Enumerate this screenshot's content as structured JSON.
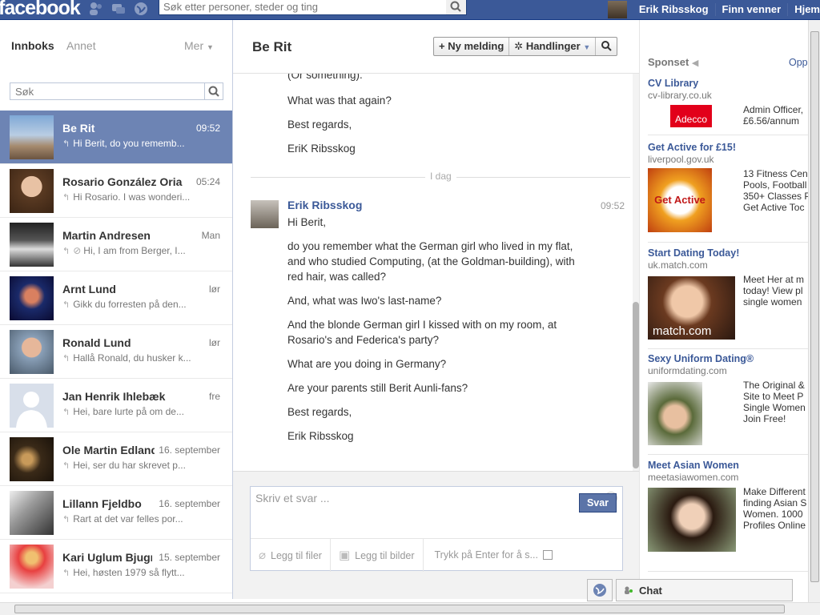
{
  "topbar": {
    "logo": "facebook",
    "search_placeholder": "Søk etter personer, steder og ting",
    "user_name": "Erik Ribsskog",
    "find_friends": "Finn venner",
    "home": "Hjem"
  },
  "inbox": {
    "tab_inbox": "Innboks",
    "tab_other": "Annet",
    "more": "Mer",
    "search_placeholder": "Søk",
    "threads": [
      {
        "name": "Be Rit",
        "time": "09:52",
        "snippet": "Hi Berit, do you rememb..."
      },
      {
        "name": "Rosario González Oria",
        "time": "05:24",
        "snippet": "Hi Rosario. I was wonderi..."
      },
      {
        "name": "Martin Andresen",
        "time": "Man",
        "snippet": "Hi, I am from Berger, I..."
      },
      {
        "name": "Arnt Lund",
        "time": "lør",
        "snippet": "Gikk du forresten på den..."
      },
      {
        "name": "Ronald Lund",
        "time": "lør",
        "snippet": "Hallå Ronald, du husker k..."
      },
      {
        "name": "Jan Henrik Ihlebæk",
        "time": "fre",
        "snippet": "Hei, bare lurte på om de..."
      },
      {
        "name": "Ole Martin Edland",
        "time": "16. september",
        "snippet": "Hei, ser du har skrevet p..."
      },
      {
        "name": "Lillann Fjeldbo",
        "time": "16. september",
        "snippet": "Rart at det var felles por..."
      },
      {
        "name": "Kari Uglum Bjugn",
        "time": "15. september",
        "snippet": "Hei, høsten 1979 så flytt..."
      }
    ]
  },
  "conversation": {
    "title": "Be Rit",
    "new_message": "Ny melding",
    "actions": "Handlinger",
    "earlier_lines": [
      "(Or something).",
      "What was that again?",
      "Best regards,",
      "EriK Ribsskog"
    ],
    "day_label": "I dag",
    "sender": "Erik Ribsskog",
    "sender_time": "09:52",
    "message_lines": [
      "Hi Berit,",
      "do you remember what the German girl who lived in my flat, and who studied Computing, (at the Goldman-building), with red hair, was called?",
      "And, what was Iwo's last-name?",
      "And the blonde German girl I kissed with on my room, at Rosario's and Federica's party?",
      "What are you doing in Germany?",
      "Are your parents still Berit Aunli-fans?",
      "Best regards,",
      "Erik Ribsskog"
    ]
  },
  "composer": {
    "placeholder": "Skriv et svar ...",
    "attach_files": "Legg til filer",
    "attach_images": "Legg til bilder",
    "enter_to_send": "Trykk på Enter for å s...",
    "send": "Svar"
  },
  "sidebar_ads": {
    "heading": "Sponset",
    "more": "Opp",
    "ads": [
      {
        "title": "CV Library",
        "url": "cv-library.co.uk",
        "img_text": "Adecco",
        "body": "Admin Officer,\n£6.56/annum"
      },
      {
        "title": "Get Active for £15!",
        "url": "liverpool.gov.uk",
        "img_text": "Get Active",
        "body": "13 Fitness Cen\nPools, Football\n350+ Classes P\nGet Active Toc"
      },
      {
        "title": "Start Dating Today!",
        "url": "uk.match.com",
        "img_text": "match.com",
        "body": "Meet Her at m\ntoday! View pl\nsingle women"
      },
      {
        "title": "Sexy Uniform Dating®",
        "url": "uniformdating.com",
        "img_text": "",
        "body": "The Original &\nSite to Meet P\nSingle Women\nJoin Free!"
      },
      {
        "title": "Meet Asian Women",
        "url": "meetasiawomen.com",
        "img_text": "",
        "body": "Make Different\nfinding Asian S\nWomen. 1000\nProfiles Online"
      }
    ]
  },
  "chat": {
    "label": "Chat"
  },
  "colors": {
    "brand": "#3b5998",
    "active_thread": "#6d84b4"
  }
}
